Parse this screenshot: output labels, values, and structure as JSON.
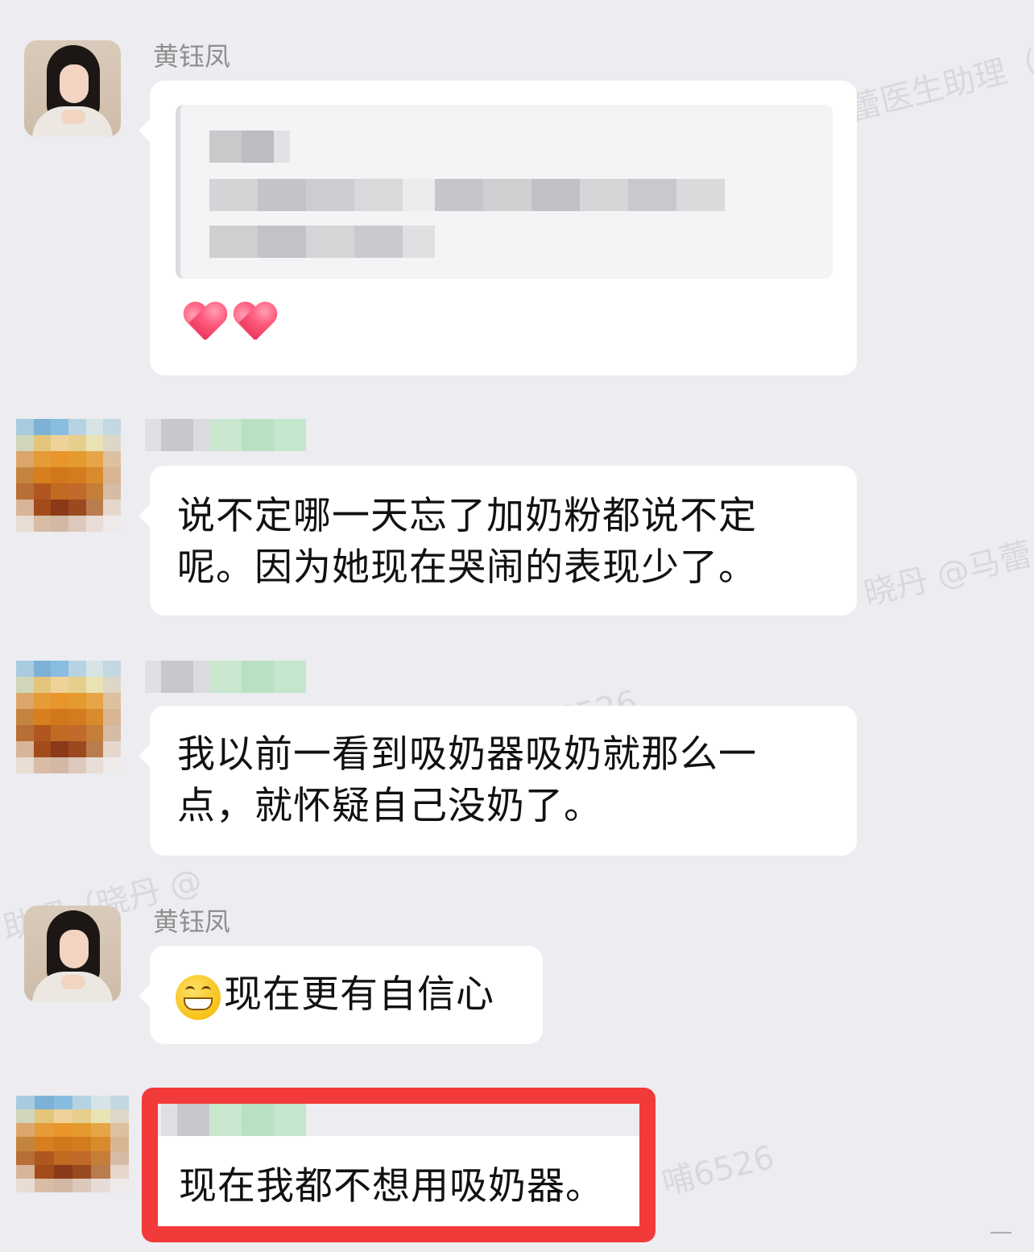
{
  "watermarks": [
    "蕾医生助理（晓",
    "晓丹 @马蕾",
    "6526",
    "助理（晓丹 @",
    "哺6526"
  ],
  "messages": [
    {
      "sender": "黄钰凤",
      "type": "quote-reply",
      "reaction": [
        "heart",
        "heart"
      ]
    },
    {
      "sender": "",
      "text_line1": "说不定哪一天忘了加奶粉都说不定",
      "text_line2": "呢。因为她现在哭闹的表现少了。"
    },
    {
      "sender": "",
      "text_line1": "我以前一看到吸奶器吸奶就那么一",
      "text_line2": "点，就怀疑自己没奶了。"
    },
    {
      "sender": "黄钰凤",
      "emoji": "grinning-face",
      "text": "现在更有自信心"
    },
    {
      "sender": "",
      "text": "现在我都不想用吸奶器。",
      "highlighted": true
    }
  ],
  "colors": {
    "background": "#ececf1",
    "bubble": "#ffffff",
    "highlight": "#f23a3a",
    "name": "#8f8f8f"
  }
}
